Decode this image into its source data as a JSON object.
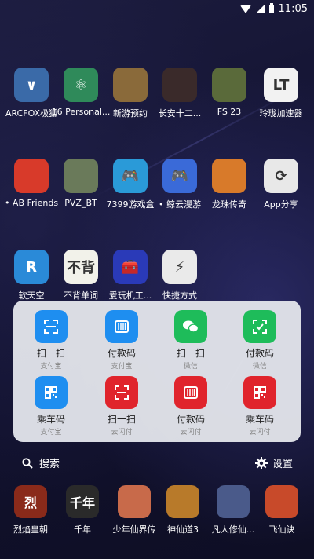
{
  "status": {
    "time": "11:05"
  },
  "apps": [
    {
      "label": "ARCFOX极狐",
      "icon": "arcfox-icon",
      "glyph": "∨",
      "color": "#3a6aa8"
    },
    {
      "label": "16 Personal...",
      "icon": "atom-icon",
      "glyph": "⚛",
      "color": "#2f8a5a"
    },
    {
      "label": "新游预约",
      "icon": "game-preview-icon",
      "glyph": "",
      "color": "#8a6a3a"
    },
    {
      "label": "长安十二...",
      "icon": "changan-game-icon",
      "glyph": "",
      "color": "#3a2a2a"
    },
    {
      "label": "FS 23",
      "icon": "farming-sim-icon",
      "glyph": "",
      "color": "#5a6a3a"
    },
    {
      "label": "玲珑加速器",
      "icon": "linglong-icon",
      "glyph": "LT",
      "color": "#f2f2f2"
    },
    {
      "label": "• AB Friends",
      "icon": "angry-birds-icon",
      "glyph": "",
      "color": "#d83a2a"
    },
    {
      "label": "PVZ_BT",
      "icon": "zombie-icon",
      "glyph": "",
      "color": "#6a7a5a"
    },
    {
      "label": "7399游戏盒",
      "icon": "gamepad-icon",
      "glyph": "🎮",
      "color": "#2a9ad8"
    },
    {
      "label": "• 鲸云漫游",
      "icon": "cloud-game-icon",
      "glyph": "🎮",
      "color": "#3a6ad8"
    },
    {
      "label": "龙珠传奇",
      "icon": "dragonball-icon",
      "glyph": "",
      "color": "#d87a2a"
    },
    {
      "label": "App分享",
      "icon": "app-share-icon",
      "glyph": "⟳",
      "color": "#e8e8e8"
    },
    {
      "label": "软天空",
      "icon": "ruantiankong-icon",
      "glyph": "R",
      "color": "#2a8ad8"
    },
    {
      "label": "不背单词",
      "icon": "bubei-icon",
      "glyph": "不背",
      "color": "#f2f2ea"
    },
    {
      "label": "爱玩机工...",
      "icon": "toolbox-icon",
      "glyph": "🧰",
      "color": "#2a3ab8"
    },
    {
      "label": "快捷方式",
      "icon": "shortcut-icon",
      "glyph": "⚡",
      "color": "#eaeaea"
    }
  ],
  "quick_actions": [
    {
      "label": "扫一扫",
      "sub": "支付宝",
      "color": "#1e8ef0",
      "icon": "scan-icon"
    },
    {
      "label": "付款码",
      "sub": "支付宝",
      "color": "#1e8ef0",
      "icon": "barcode-icon"
    },
    {
      "label": "扫一扫",
      "sub": "微信",
      "color": "#1ebc5a",
      "icon": "wechat-icon"
    },
    {
      "label": "付款码",
      "sub": "微信",
      "color": "#1ebc5a",
      "icon": "qrcode-scan-icon"
    },
    {
      "label": "乘车码",
      "sub": "支付宝",
      "color": "#1e8ef0",
      "icon": "qrcode-icon"
    },
    {
      "label": "扫一扫",
      "sub": "云闪付",
      "color": "#e0242c",
      "icon": "scan-icon"
    },
    {
      "label": "付款码",
      "sub": "云闪付",
      "color": "#e0242c",
      "icon": "barcode-icon"
    },
    {
      "label": "乘车码",
      "sub": "云闪付",
      "color": "#e0242c",
      "icon": "qrcode-icon"
    }
  ],
  "search": {
    "label": "搜索"
  },
  "settings": {
    "label": "设置"
  },
  "dock": [
    {
      "label": "烈焰皇朝",
      "icon": "lieyan-icon",
      "glyph": "烈",
      "color": "#8a2a1a"
    },
    {
      "label": "千年",
      "icon": "qiannian-icon",
      "glyph": "千年",
      "color": "#2a2a2a"
    },
    {
      "label": "少年仙界传",
      "icon": "shaonian-icon",
      "glyph": "",
      "color": "#c86a4a"
    },
    {
      "label": "神仙道3",
      "icon": "shenxian-icon",
      "glyph": "",
      "color": "#b87a2a"
    },
    {
      "label": "凡人修仙...",
      "icon": "fanren-icon",
      "glyph": "",
      "color": "#4a5a8a"
    },
    {
      "label": "飞仙诀",
      "icon": "feixian-icon",
      "glyph": "",
      "color": "#c84a2a"
    }
  ]
}
